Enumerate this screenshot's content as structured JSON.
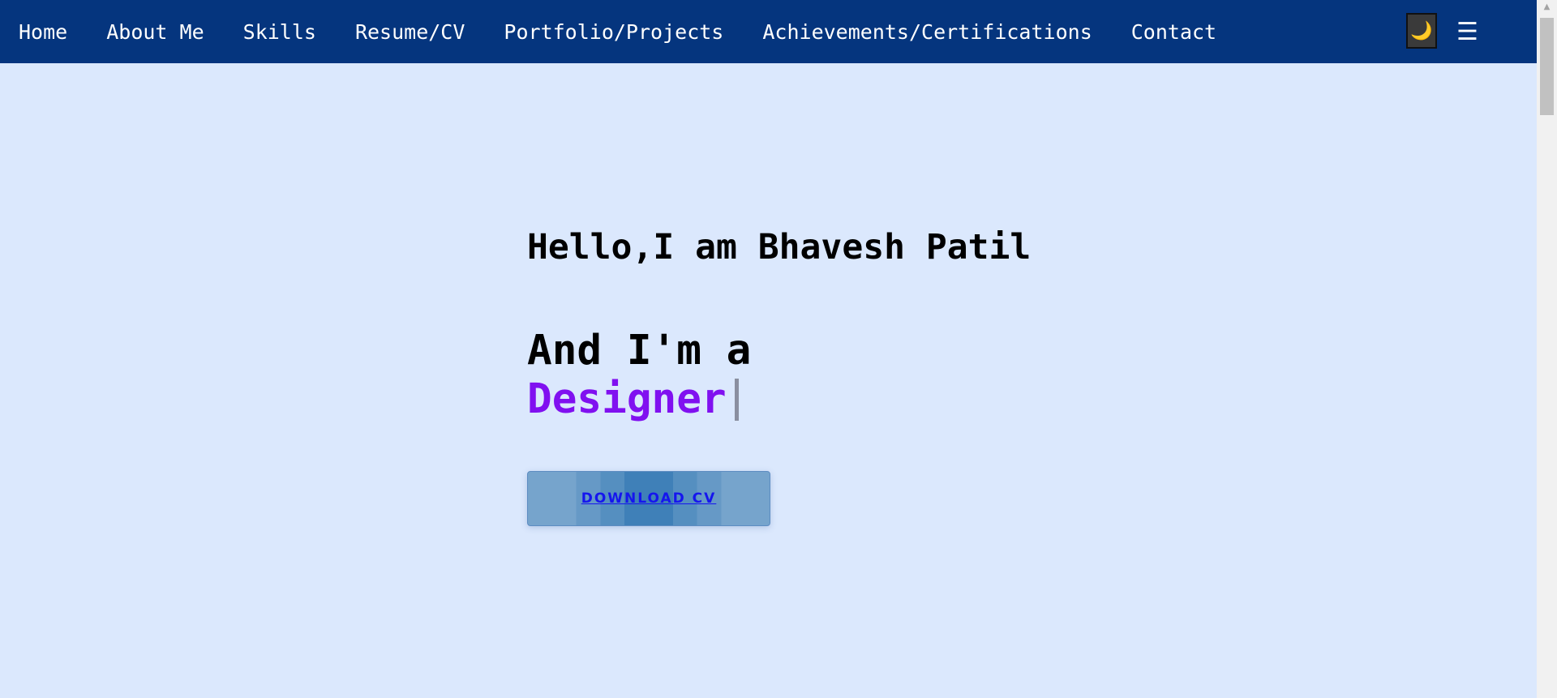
{
  "nav": {
    "links": [
      "Home",
      "About Me",
      "Skills",
      "Resume/CV",
      "Portfolio/Projects",
      "Achievements/Certifications",
      "Contact"
    ],
    "theme_toggle_icon": "moon-icon",
    "theme_toggle_glyph": "🌙",
    "menu_icon": "hamburger-menu-icon",
    "menu_glyph": "☰"
  },
  "hero": {
    "greeting": "Hello,I am Bhavesh Patil",
    "role_prefix": "And I'm a",
    "role": "Designer",
    "download_label": "DOWNLOAD CV"
  },
  "colors": {
    "navbar": "#05357e",
    "background": "#dbe8fd",
    "role_accent": "#8010f0",
    "button_link": "#1515ee"
  }
}
